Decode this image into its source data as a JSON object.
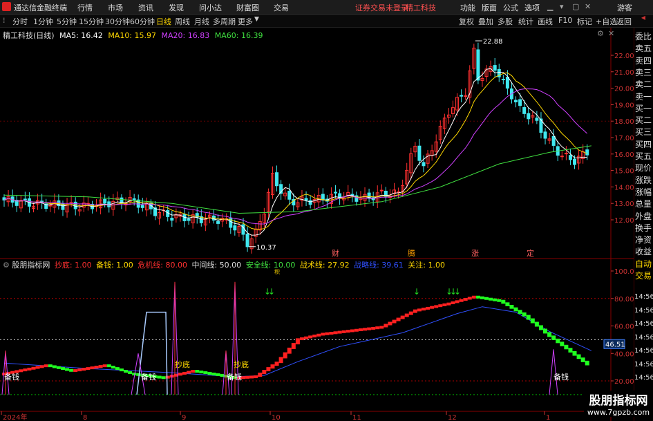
{
  "titlebar": {
    "app_name": "通达信金融终端",
    "menu": [
      "行情",
      "市场",
      "资讯",
      "发现",
      "问小达",
      "财富圈",
      "交易"
    ],
    "warning": "证券交易未登录",
    "stock": "精工科技",
    "right_menu": [
      "功能",
      "版面",
      "公式",
      "选项"
    ],
    "guest": "游客"
  },
  "periodbar": {
    "periods": [
      "分时",
      "1分钟",
      "5分钟",
      "15分钟",
      "30分钟",
      "60分钟",
      "日线",
      "周线",
      "月线",
      "多周期",
      "更多"
    ],
    "active": "日线",
    "right_buttons": [
      "复权",
      "叠加",
      "多股",
      "统计",
      "画线",
      "F10",
      "标记",
      "+自选",
      "返回"
    ]
  },
  "main_chart": {
    "title": "精工科技(日线)",
    "ma": [
      {
        "label": "MA5: 16.42",
        "color": "#ffffff"
      },
      {
        "label": "MA10: 15.97",
        "color": "#ffd800"
      },
      {
        "label": "MA20: 16.83",
        "color": "#d040ff"
      },
      {
        "label": "MA60: 16.39",
        "color": "#40e040"
      }
    ],
    "high_label": "22.88",
    "low_label": "10.37",
    "y_ticks": [
      "22.00",
      "21.00",
      "20.00",
      "19.00",
      "18.00",
      "17.00",
      "16.00",
      "15.00",
      "14.00",
      "13.00",
      "12.00"
    ],
    "event_markers": [
      "财",
      "腾",
      "涨",
      "定"
    ]
  },
  "sub_chart": {
    "title": "股朋指标网",
    "legend": [
      {
        "label": "抄底: 1.00",
        "color": "#ff3030"
      },
      {
        "label": "备钱: 1.00",
        "color": "#ffd800"
      },
      {
        "label": "危机线: 80.00",
        "color": "#ff3030"
      },
      {
        "label": "中间线: 50.00",
        "color": "#dddddd"
      },
      {
        "label": "安全线: 10.00",
        "color": "#40e040"
      },
      {
        "label": "战术线: 27.92",
        "color": "#ffd800"
      },
      {
        "label": "战略线: 39.61",
        "color": "#3050ff"
      },
      {
        "label": "关注: 1.00",
        "color": "#ffd800"
      }
    ],
    "y_ticks": [
      "100.0",
      "80.00",
      "60.00",
      "40.00",
      "20.00"
    ],
    "value_box": "46.51",
    "annotations": [
      "抄底",
      "抄底",
      "备钱",
      "备钱",
      "备钱",
      "备钱"
    ],
    "small_marker": "积"
  },
  "x_axis": {
    "labels": [
      "2024年",
      "8",
      "9",
      "10",
      "11",
      "12",
      "1"
    ]
  },
  "side_panel": {
    "items": [
      "委比",
      "卖五",
      "卖四",
      "卖三",
      "卖二",
      "卖一",
      "买一",
      "买二",
      "买三",
      "买四",
      "买五",
      "现价",
      "涨跌",
      "涨幅",
      "总量",
      "外盘",
      "换手",
      "净资",
      "收益",
      "自动",
      "交易"
    ],
    "time_labels": [
      "14:56",
      "14:56",
      "14:56",
      "14:56",
      "14:56",
      "14:56",
      "14:56"
    ]
  },
  "watermark": {
    "line1": "股朋指标网",
    "line2": "www.7gpzb.com"
  },
  "colors": {
    "up": "#ff3030",
    "down": "#40e8f0",
    "ma5": "#ffffff",
    "ma10": "#ffd800",
    "ma20": "#d040ff",
    "ma60": "#40e040"
  }
}
